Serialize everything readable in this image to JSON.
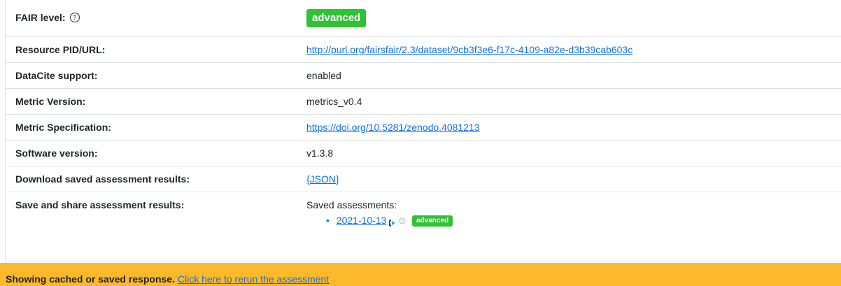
{
  "rows": {
    "fair_level": {
      "label": "FAIR level:",
      "help_icon": "?",
      "badge": "advanced"
    },
    "pid": {
      "label": "Resource PID/URL:",
      "value": "http://purl.org/fairsfair/2.3/dataset/9cb3f3e6-f17c-4109-a82e-d3b39cab603c"
    },
    "datacite": {
      "label": "DataCite support:",
      "value": "enabled"
    },
    "metric_version": {
      "label": "Metric Version:",
      "value": "metrics_v0.4"
    },
    "metric_spec": {
      "label": "Metric Specification:",
      "value": "https://doi.org/10.5281/zenodo.4081213"
    },
    "software_version": {
      "label": "Software version:",
      "value": "v1.3.8"
    },
    "download": {
      "label": "Download saved assessment results:",
      "value": "{JSON}"
    },
    "save_share": {
      "label": "Save and share assessment results:",
      "heading": "Saved assessments:",
      "items": [
        {
          "date": "2021-10-13",
          "badge": "advanced"
        }
      ]
    }
  },
  "banner": {
    "text": "Showing cached or saved response.",
    "link": "Click here to rerun the assessment"
  },
  "colors": {
    "badge_green": "#2fc233",
    "link_blue": "#0d6efd",
    "banner_bg": "#fbb92b"
  },
  "icons": {
    "help": "help-icon",
    "edit": "edit-icon",
    "settings": "gear-icon"
  }
}
